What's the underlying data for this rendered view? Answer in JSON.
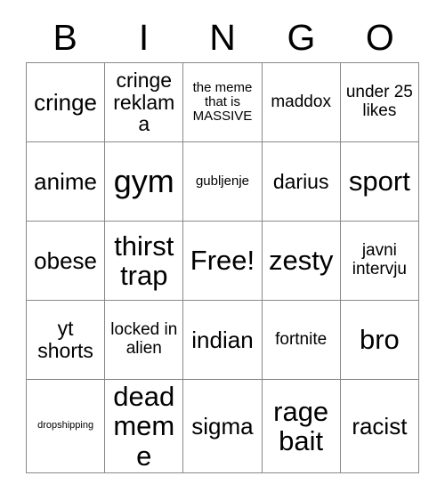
{
  "card": {
    "title": "BINGO",
    "columns": [
      {
        "letter": "B"
      },
      {
        "letter": "I"
      },
      {
        "letter": "N"
      },
      {
        "letter": "G"
      },
      {
        "letter": "O"
      }
    ],
    "colors": {
      "background": "#ffffff",
      "text": "#000000",
      "grid_line": "#888888"
    },
    "rows": [
      [
        {
          "text": "cringe",
          "size": "xl"
        },
        {
          "text": "cringe reklama",
          "size": "lg"
        },
        {
          "text": "the meme that is MASSIVE",
          "size": "sm"
        },
        {
          "text": "maddox",
          "size": "md"
        },
        {
          "text": "under 25 likes",
          "size": "md"
        }
      ],
      [
        {
          "text": "anime",
          "size": "xl"
        },
        {
          "text": "gym",
          "size": "huge"
        },
        {
          "text": "gubljenje",
          "size": "sm"
        },
        {
          "text": "darius",
          "size": "lg"
        },
        {
          "text": "sport",
          "size": "xxl"
        }
      ],
      [
        {
          "text": "obese",
          "size": "xl"
        },
        {
          "text": "thirst trap",
          "size": "xxl"
        },
        {
          "text": "Free!",
          "size": "xxl"
        },
        {
          "text": "zesty",
          "size": "xxl"
        },
        {
          "text": "javni intervju",
          "size": "md"
        }
      ],
      [
        {
          "text": "yt shorts",
          "size": "lg"
        },
        {
          "text": "locked in alien",
          "size": "md"
        },
        {
          "text": "indian",
          "size": "xl"
        },
        {
          "text": "fortnite",
          "size": "md"
        },
        {
          "text": "bro",
          "size": "xxl"
        }
      ],
      [
        {
          "text": "dropshipping",
          "size": "xs"
        },
        {
          "text": "dead meme",
          "size": "xxl"
        },
        {
          "text": "sigma",
          "size": "xl"
        },
        {
          "text": "rage bait",
          "size": "xxl"
        },
        {
          "text": "racist",
          "size": "xl"
        }
      ]
    ],
    "free_space": {
      "row": 2,
      "column": 2,
      "label": "Free!"
    }
  }
}
